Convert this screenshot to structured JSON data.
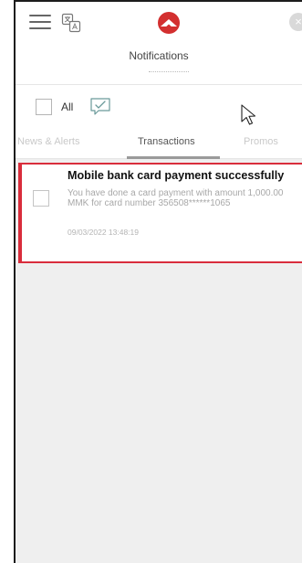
{
  "header": {
    "title": "Notifications",
    "icons": {
      "menu": "hamburger-menu-icon",
      "translate": "translate-icon",
      "logo": "bank-logo-icon",
      "close": "close-icon"
    },
    "logo_color": "#d32f2f"
  },
  "filter": {
    "all_label": "All",
    "select_all_checked": false
  },
  "tabs": [
    {
      "label": "News & Alerts",
      "active": false
    },
    {
      "label": "Transactions",
      "active": true
    },
    {
      "label": "Promos",
      "active": false
    }
  ],
  "notifications": [
    {
      "title": "Mobile bank card payment successfully",
      "body": "You have done a card payment with amount 1,000.00 MMK for card number 356508******1065",
      "date": "09/03/2022 13:48:19",
      "selected": false,
      "highlight_color": "#d92d3c"
    }
  ]
}
